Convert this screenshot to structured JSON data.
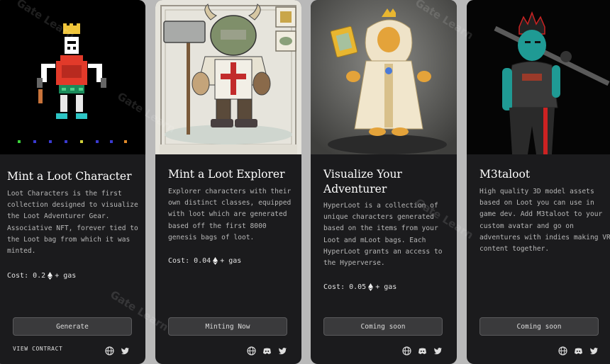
{
  "cards": [
    {
      "title": "Mint a Loot Character",
      "description": "Loot Characters is the first collection designed to visualize the Loot Adventurer Gear. Associative NFT, forever tied to the Loot bag from which it was minted.",
      "cost_label": "Cost: 0.2",
      "cost_suffix": "+ gas",
      "button": "Generate",
      "contract_link": "VIEW CONTRACT",
      "icons": [
        "globe-icon",
        "twitter-icon"
      ]
    },
    {
      "title": "Mint a Loot Explorer",
      "description": "Explorer characters with their own distinct classes, equipped with loot which are generated based off the first 8000 genesis bags of loot.",
      "cost_label": "Cost: 0.04",
      "cost_suffix": "+ gas",
      "button": "Minting Now",
      "icons": [
        "globe-icon",
        "discord-icon",
        "twitter-icon"
      ]
    },
    {
      "title": "Visualize Your Adventurer",
      "description": "HyperLoot is a collection of unique characters generated based on the items from your Loot and mLoot bags. Each HyperLoot grants an access to the Hyperverse.",
      "cost_label": "Cost: 0.05",
      "cost_suffix": "+ gas",
      "button": "Coming soon",
      "icons": [
        "globe-icon",
        "discord-icon",
        "twitter-icon"
      ]
    },
    {
      "title": "M3taloot",
      "description": "High quality 3D model assets based on Loot you can use in game dev. Add M3taloot to your custom avatar and go on adventures with indies making VR content together.",
      "button": "Coming soon",
      "icons": [
        "globe-icon",
        "discord-icon",
        "twitter-icon"
      ]
    }
  ],
  "watermark": "Gate Learn",
  "colors": {
    "card_bg": "#1b1b1d",
    "page_bg": "#b9b9b9",
    "button_bg": "#3a3a3c"
  }
}
